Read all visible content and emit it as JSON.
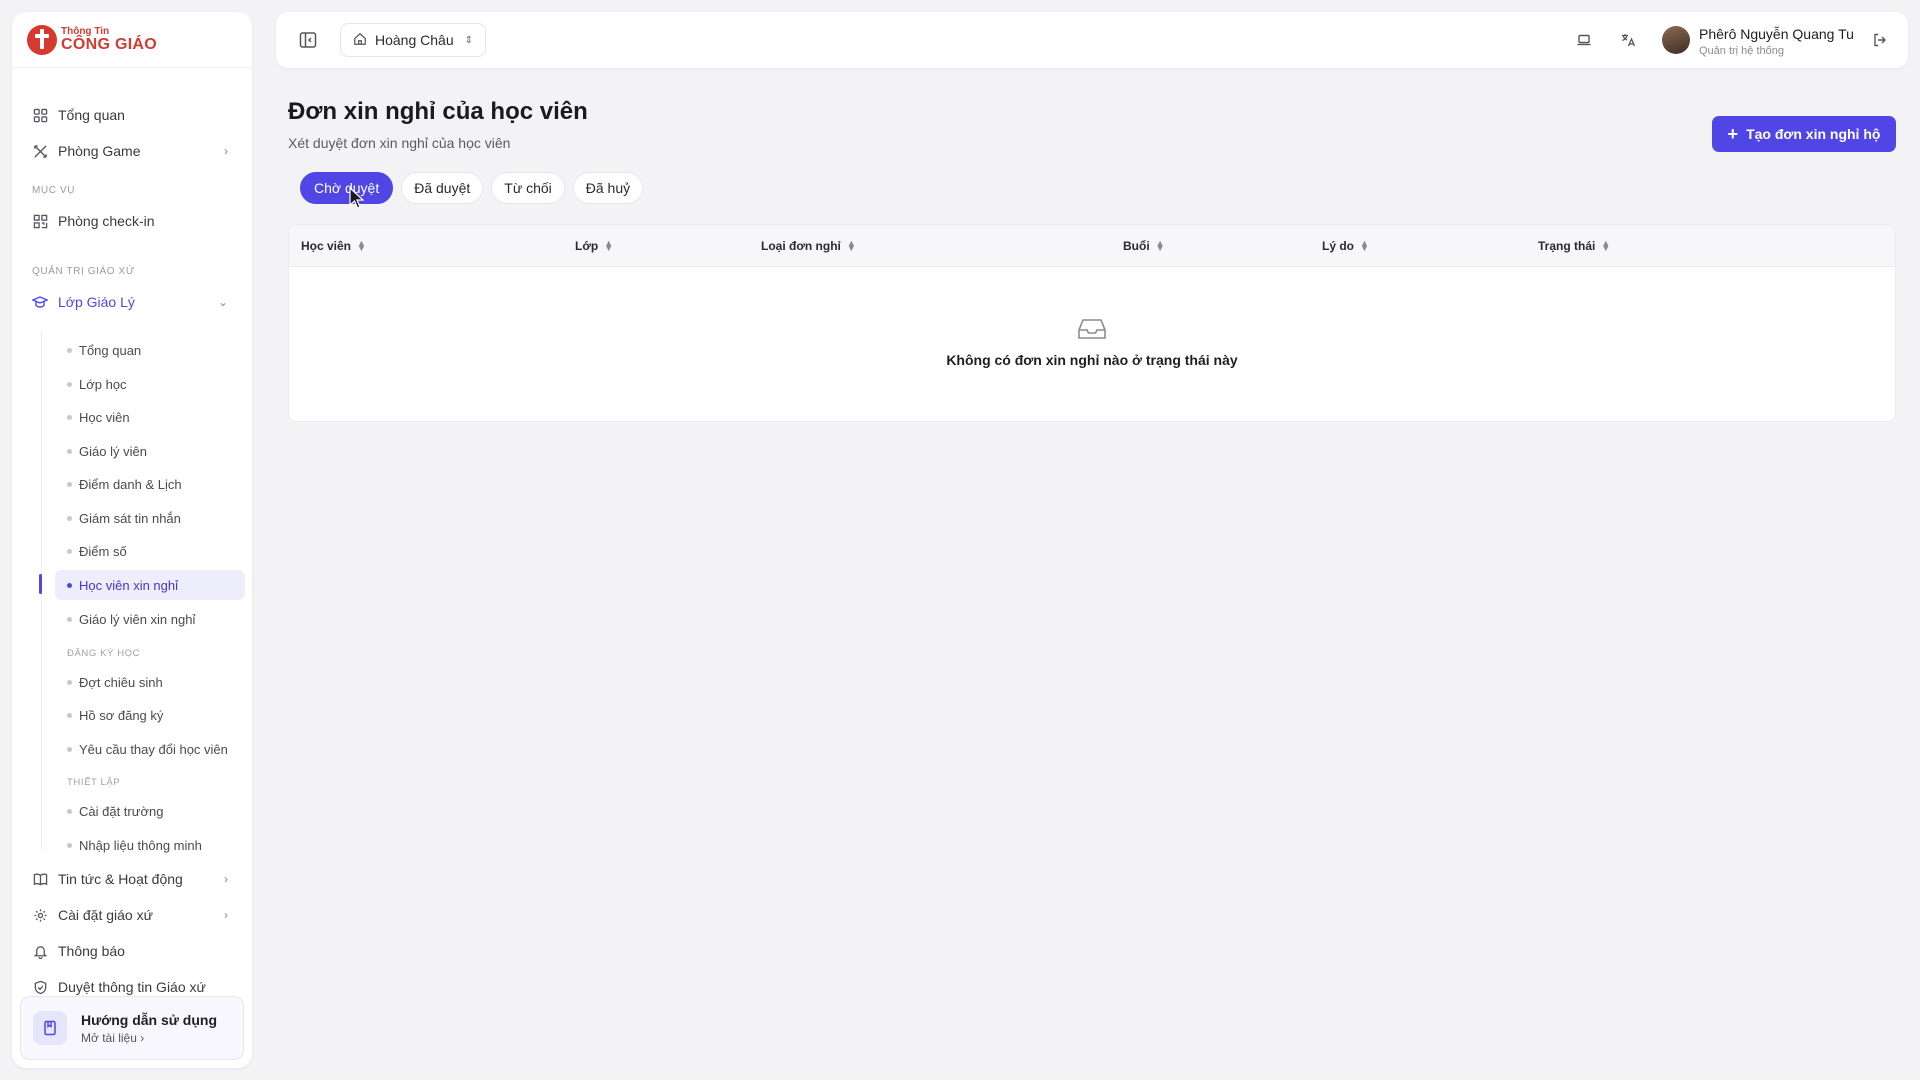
{
  "brand": {
    "line1": "Thông Tin",
    "line2": "CÔNG GIÁO",
    "color": "#d63a2f"
  },
  "accent": "#4f46e5",
  "sidebar": {
    "top_items": [
      {
        "label": "Tổng quan",
        "icon": "dashboard-icon"
      },
      {
        "label": "Phòng Game",
        "icon": "game-icon"
      }
    ],
    "section_ministry": "MỤC VỤ",
    "checkin": {
      "label": "Phòng check-in",
      "icon": "qr-icon"
    },
    "section_admin": "QUẢN TRỊ GIÁO XỨ",
    "catechism": {
      "label": "Lớp Giáo Lý",
      "icon": "graduation-cap-icon"
    },
    "sub_items": [
      "Tổng quan",
      "Lớp học",
      "Học viên",
      "Giáo lý viên",
      "Điểm danh & Lịch",
      "Giám sát tin nhắn",
      "Điểm số",
      "Học viên xin nghỉ",
      "Giáo lý viên xin nghỉ"
    ],
    "section_enroll": "ĐĂNG KÝ HỌC",
    "enroll_items": [
      "Đợt chiêu sinh",
      "Hồ sơ đăng ký",
      "Yêu cầu thay đổi học viên"
    ],
    "section_setup": "THIẾT LẬP",
    "setup_items": [
      "Cài đặt trường",
      "Nhập liệu thông minh"
    ],
    "bottom_items": [
      {
        "label": "Tin tức & Hoạt động",
        "icon": "book-icon"
      },
      {
        "label": "Cài đặt giáo xứ",
        "icon": "gear-icon"
      },
      {
        "label": "Thông báo",
        "icon": "bell-icon"
      },
      {
        "label": "Duyệt thông tin Giáo xứ",
        "icon": "shield-icon"
      }
    ],
    "guide": {
      "title": "Hướng dẫn sử dụng",
      "link": "Mở tài liệu"
    }
  },
  "topbar": {
    "parish": "Hoàng Châu",
    "user_name": "Phêrô Nguyễn Quang Tu",
    "user_role": "Quản trị hệ thống"
  },
  "main": {
    "title": "Đơn xin nghỉ của học viên",
    "subtitle": "Xét duyệt đơn xin nghỉ của học viên",
    "create_button": "Tạo đơn xin nghỉ hộ",
    "tabs": [
      "Chờ duyệt",
      "Đã duyệt",
      "Từ chối",
      "Đã huỷ"
    ],
    "active_tab": "Chờ duyệt",
    "columns": [
      "Học viên",
      "Lớp",
      "Loại đơn nghỉ",
      "Buổi",
      "Lý do",
      "Trạng thái"
    ],
    "rows": [],
    "empty_text": "Không có đơn xin nghỉ nào ở trạng thái này"
  }
}
